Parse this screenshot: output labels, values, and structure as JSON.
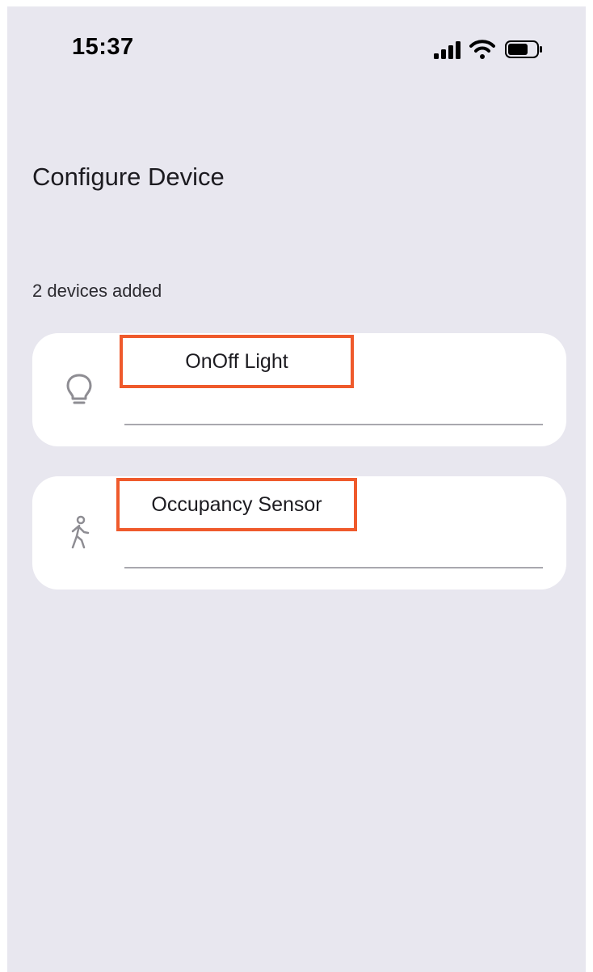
{
  "status_bar": {
    "time": "15:37",
    "icons": [
      "cellular-signal-icon",
      "wifi-icon",
      "battery-icon"
    ]
  },
  "page": {
    "title": "Configure Device",
    "devices_count": "2 devices added"
  },
  "devices": [
    {
      "name": "OnOff Light",
      "icon": "lightbulb-icon"
    },
    {
      "name": "Occupancy Sensor",
      "icon": "walking-person-icon"
    }
  ],
  "colors": {
    "background": "#e8e7ef",
    "card": "#ffffff",
    "highlight": "#ef5a2c",
    "underline": "#a9a8ae",
    "icon": "#8e8d93"
  }
}
